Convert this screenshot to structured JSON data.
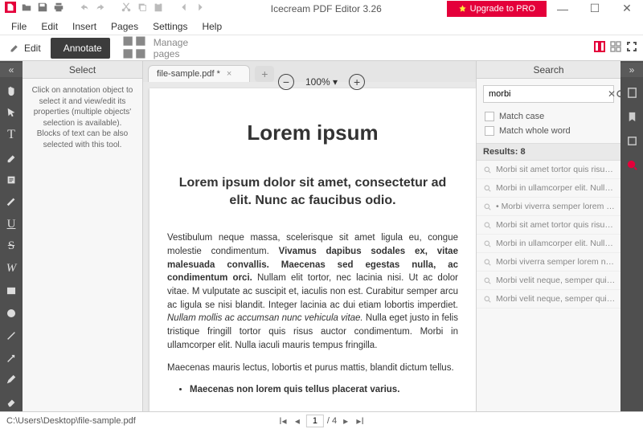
{
  "title": "Icecream PDF Editor 3.26",
  "upgrade": "Upgrade to PRO",
  "menu": [
    "File",
    "Edit",
    "Insert",
    "Pages",
    "Settings",
    "Help"
  ],
  "toolbar": {
    "edit": "Edit",
    "annotate": "Annotate",
    "manage": "Manage pages"
  },
  "zoom": "100%",
  "tab": "file-sample.pdf *",
  "leftpanel": {
    "title": "Select",
    "desc": "Click on annotation object to select it and view/edit its properties (multiple objects' selection is available). Blocks of text can be also selected with this tool."
  },
  "doc": {
    "h1": "Lorem ipsum",
    "h2": "Lorem ipsum dolor sit amet, consectetur ad elit. Nunc ac faucibus odio.",
    "p1a": "Vestibulum neque massa, scelerisque sit amet ligula eu, congue molestie condimentum. ",
    "p1b": "Vivamus dapibus sodales ex, vitae malesuada convallis. Maecenas sed egestas nulla, ac condimentum orci.",
    "p1c": " Nullam elit tortor, nec lacinia nisi. Ut ac dolor vitae. M vulputate ac suscipit et, iaculis non est. Curabitur semper arcu ac ligula se nisi blandit. Integer lacinia ac dui etiam lobortis imperdiet. ",
    "p1d": "Nullam mollis ac accumsan nunc vehicula vitae.",
    "p1e": " Nulla eget justo in felis tristique fringill tortor quis risus auctor condimentum. Morbi in ullamcorper elit. Nulla iaculi mauris tempus fringilla.",
    "p2": "Maecenas mauris lectus, lobortis et purus mattis, blandit dictum tellus.",
    "li1": "Maecenas non lorem quis tellus placerat varius."
  },
  "rightpanel": {
    "title": "Search",
    "query": "morbi",
    "matchcase": "Match case",
    "matchword": "Match whole word",
    "resultshead": "Results: 8"
  },
  "results": [
    "Morbi sit amet tortor quis risu…",
    "Morbi in ullamcorper elit. Null…",
    "• Morbi viverra semper lorem …",
    "Morbi sit amet tortor quis risu…",
    "Morbi in ullamcorper elit. Null…",
    "Morbi viverra semper lorem n…",
    "Morbi velit neque, semper qui…",
    "Morbi velit neque, semper qui…"
  ],
  "status": {
    "path": "C:\\Users\\Desktop\\file-sample.pdf",
    "page": "1",
    "pages": "/ 4"
  }
}
